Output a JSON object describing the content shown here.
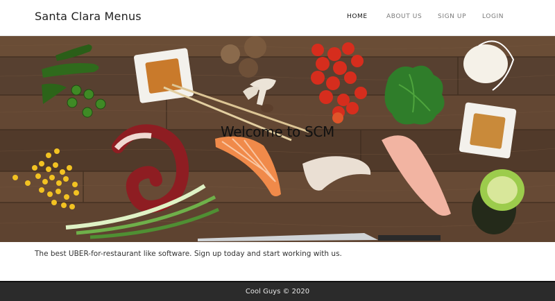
{
  "navbar": {
    "brand": "Santa Clara Menus",
    "links": [
      {
        "label": "HOME"
      },
      {
        "label": "ABOUT US"
      },
      {
        "label": "SIGN UP"
      },
      {
        "label": "LOGIN"
      }
    ]
  },
  "hero": {
    "title": "Welcome to SCM"
  },
  "tagline": "The best UBER-for-restaurant like software. Sign up today and start working with us.",
  "footer": {
    "text": "Cool Guys © 2020"
  }
}
